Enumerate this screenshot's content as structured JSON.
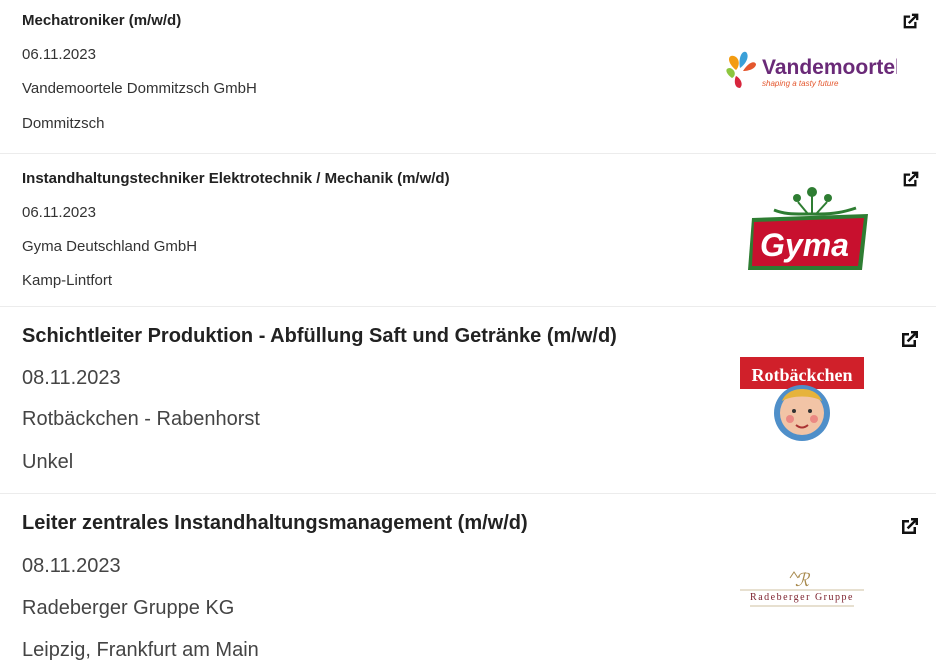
{
  "jobs": [
    {
      "title": "Mechatroniker (m/w/d)",
      "date": "06.11.2023",
      "company": "Vandemoortele Dommitzsch GmbH",
      "location": "Dommitzsch",
      "logo": {
        "name": "Vandemoortele",
        "tagline": "shaping a tasty future",
        "color": "#6a2a78"
      }
    },
    {
      "title": "Instandhaltungstechniker Elektrotechnik / Mechanik (m/w/d)",
      "date": "06.11.2023",
      "company": "Gyma Deutschland GmbH",
      "location": "Kamp-Lintfort",
      "logo": {
        "name": "Gyma",
        "color": "#c8102e"
      }
    },
    {
      "title": "Schichtleiter Produktion - Abfüllung Saft und Getränke (m/w/d)",
      "date": "08.11.2023",
      "company": "Rotbäckchen - Rabenhorst",
      "location": "Unkel",
      "logo": {
        "name": "Rotbäckchen",
        "color": "#d0202a"
      }
    },
    {
      "title": "Leiter zentrales Instandhaltungsmanagement (m/w/d)",
      "date": "08.11.2023",
      "company": "Radeberger Gruppe KG",
      "location": "Leipzig, Frankfurt am Main",
      "logo": {
        "name": "Radeberger Gruppe",
        "color": "#7a1d2a"
      }
    }
  ],
  "icons": {
    "external_link": "external-link-icon"
  }
}
